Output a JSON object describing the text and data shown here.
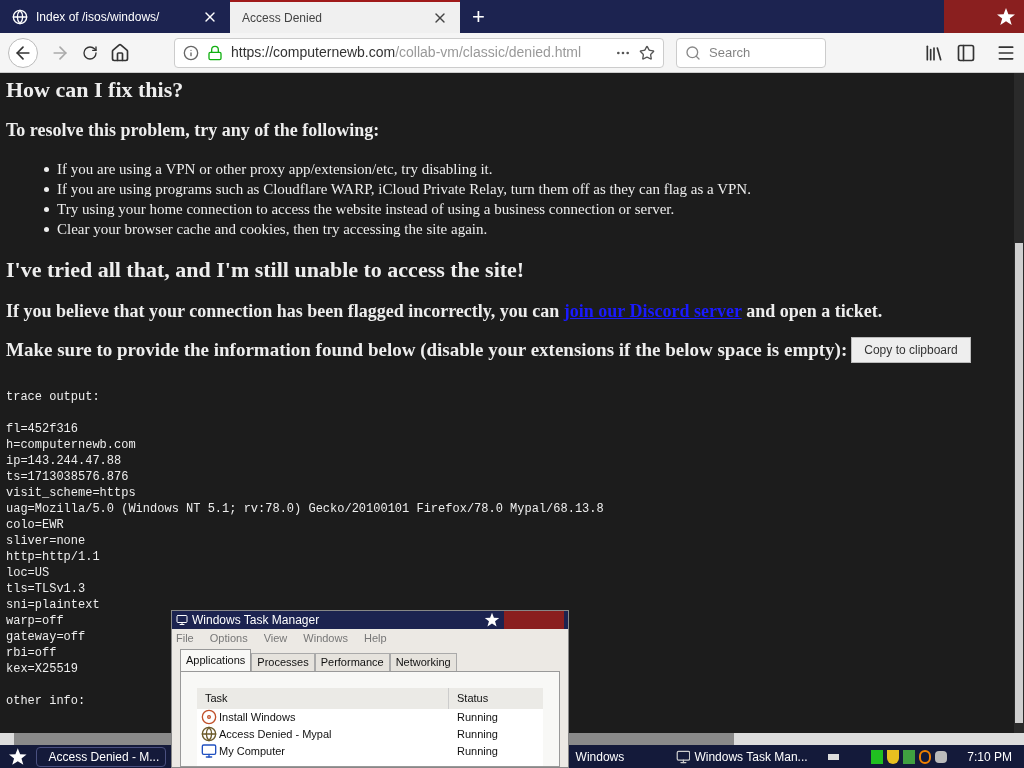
{
  "browser": {
    "tabs": [
      {
        "title": "Index of /isos/windows/",
        "selected": false
      },
      {
        "title": "Access Denied",
        "selected": true
      }
    ],
    "new_tab": "+",
    "url": {
      "host": "https://computernewb.com",
      "path": "/collab-vm/classic/denied.html"
    },
    "search": {
      "placeholder": "Search"
    }
  },
  "page": {
    "heading": "How can I fix this?",
    "subheading": "To resolve this problem, try any of the following:",
    "tips": [
      "If you are using a VPN or other proxy app/extension/etc, try disabling it.",
      "If you are using programs such as Cloudflare WARP, iCloud Private Relay, turn them off as they can flag as a VPN.",
      "Try using your home connection to access the website instead of using a business connection or server.",
      "Clear your browser cache and cookies, then try accessing the site again."
    ],
    "heading_2": "I've tried all that, and I'm still unable to access the site!",
    "flagged": {
      "before": "If you believe that your connection has been flagged incorrectly, you can",
      "link": "join our Discord server",
      "after": "and open a ticket."
    },
    "provide": "Make sure to provide the information found below (disable your extensions if the below space is empty):",
    "copy_button": "Copy to clipboard",
    "trace_header": "trace output:",
    "trace_lines": [
      "fl=452f316",
      "h=computernewb.com",
      "ip=143.244.47.88",
      "ts=1713038576.876",
      "visit_scheme=https",
      "uag=Mozilla/5.0 (Windows NT 5.1; rv:78.0) Gecko/20100101 Firefox/78.0 Mypal/68.13.8",
      "colo=EWR",
      "sliver=none",
      "http=http/1.1",
      "loc=US",
      "tls=TLSv1.3",
      "sni=plaintext",
      "warp=off",
      "gateway=off",
      "rbi=off",
      "kex=X25519"
    ],
    "other_info": "other info:"
  },
  "task_manager": {
    "title": "Windows Task Manager",
    "menu": [
      "File",
      "Options",
      "View",
      "Windows",
      "Help"
    ],
    "tabs": [
      {
        "label": "Applications",
        "selected": true
      },
      {
        "label": "Processes",
        "selected": false
      },
      {
        "label": "Performance",
        "selected": false
      },
      {
        "label": "Networking",
        "selected": false
      }
    ],
    "columns": [
      "Task",
      "Status"
    ],
    "rows": [
      {
        "task": "Install Windows",
        "status": "Running",
        "kind": "installer"
      },
      {
        "task": "Access Denied - Mypal",
        "status": "Running",
        "kind": "browser"
      },
      {
        "task": "My Computer",
        "status": "Running",
        "kind": "computer"
      }
    ]
  },
  "taskbar": {
    "buttons": [
      {
        "label": "Access Denied - M...",
        "kind": "browser"
      },
      {
        "label": "Windows",
        "kind": "none"
      },
      {
        "label": "Windows Task Man...",
        "kind": "taskmgr"
      }
    ],
    "clock": "7:10 PM"
  }
}
